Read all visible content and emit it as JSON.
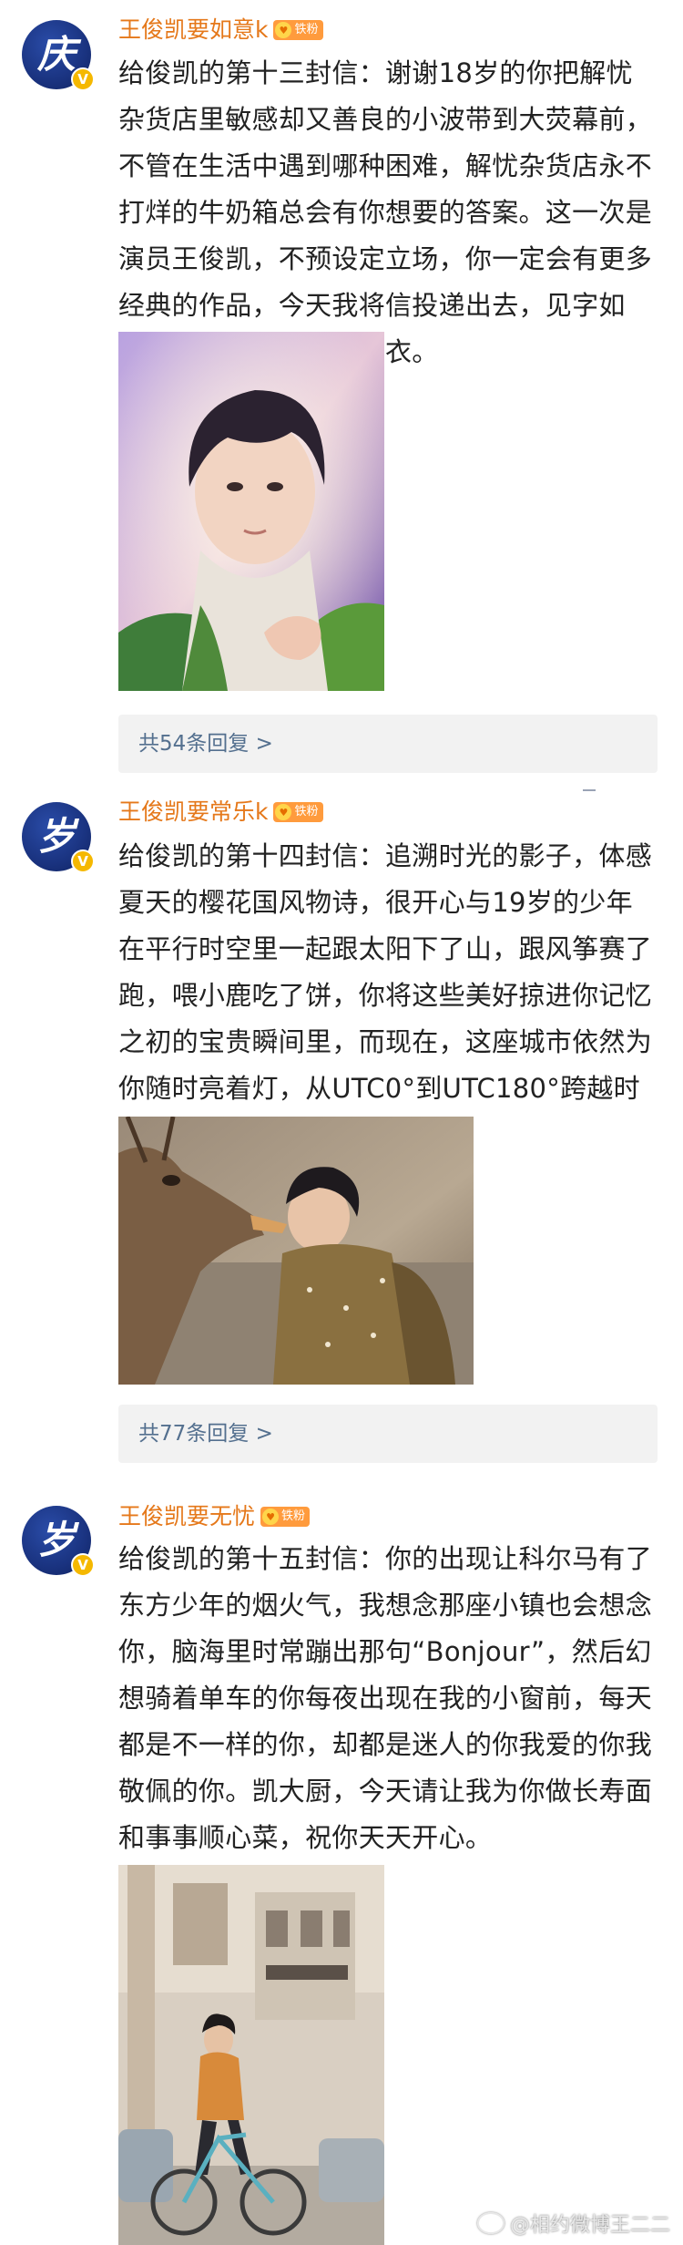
{
  "posts": [
    {
      "avatar_char": "庆",
      "vip": "V",
      "username": "王俊凯要如意k",
      "fan_badge": "铁粉",
      "text": "给俊凯的第十三封信：谢谢18岁的你把解忧杂货店里敏感却又善良的小波带到大荧幕前，不管在生活中遇到哪种困难，解忧杂货店永不打烊的牛奶箱总会有你想要的答案。这一次是演员王俊凯，不预设定立场，你一定会有更多经典的作品，今天我将信投递出去，见字如面，天气转凉，及时添衣。",
      "photo_icon": "portrait-photo",
      "replies": "共54条回复 >"
    },
    {
      "avatar_char": "岁",
      "vip": "V",
      "username": "王俊凯要常乐k",
      "fan_badge": "铁粉",
      "text": "给俊凯的第十四封信：追溯时光的影子，体感夏天的樱花国风物诗，很开心与19岁的少年在平行时空里一起跟太阳下了山，跟风筝赛了跑，喂小鹿吃了饼，你将这些美好掠进你记忆之初的宝贵瞬间里，而现在，这座城市依然为你随时亮着灯，从UTC0°到UTC180°跨越时空距离，看到我也看到你。",
      "photo_icon": "deer-photo",
      "replies": "共77条回复 >"
    },
    {
      "avatar_char": "岁",
      "vip": "V",
      "username": "王俊凯要无忧",
      "fan_badge": "铁粉",
      "text": "给俊凯的第十五封信：你的出现让科尔马有了东方少年的烟火气，我想念那座小镇也会想念你，脑海里时常蹦出那句“Bonjour”，然后幻想骑着单车的你每夜出现在我的小窗前，每天都是不一样的你，却都是迷人的你我爱的你我敬佩的你。凯大厨，今天请让我为你做长寿面和事事顺心菜，祝你天天开心。",
      "photo_icon": "bicycle-photo"
    }
  ],
  "watermark": "@相约微博王二二",
  "colors": {
    "username": "#e5781a",
    "reply_link": "#54708f",
    "avatar_bg": "#1a3380",
    "vip_badge": "#f5b800"
  }
}
